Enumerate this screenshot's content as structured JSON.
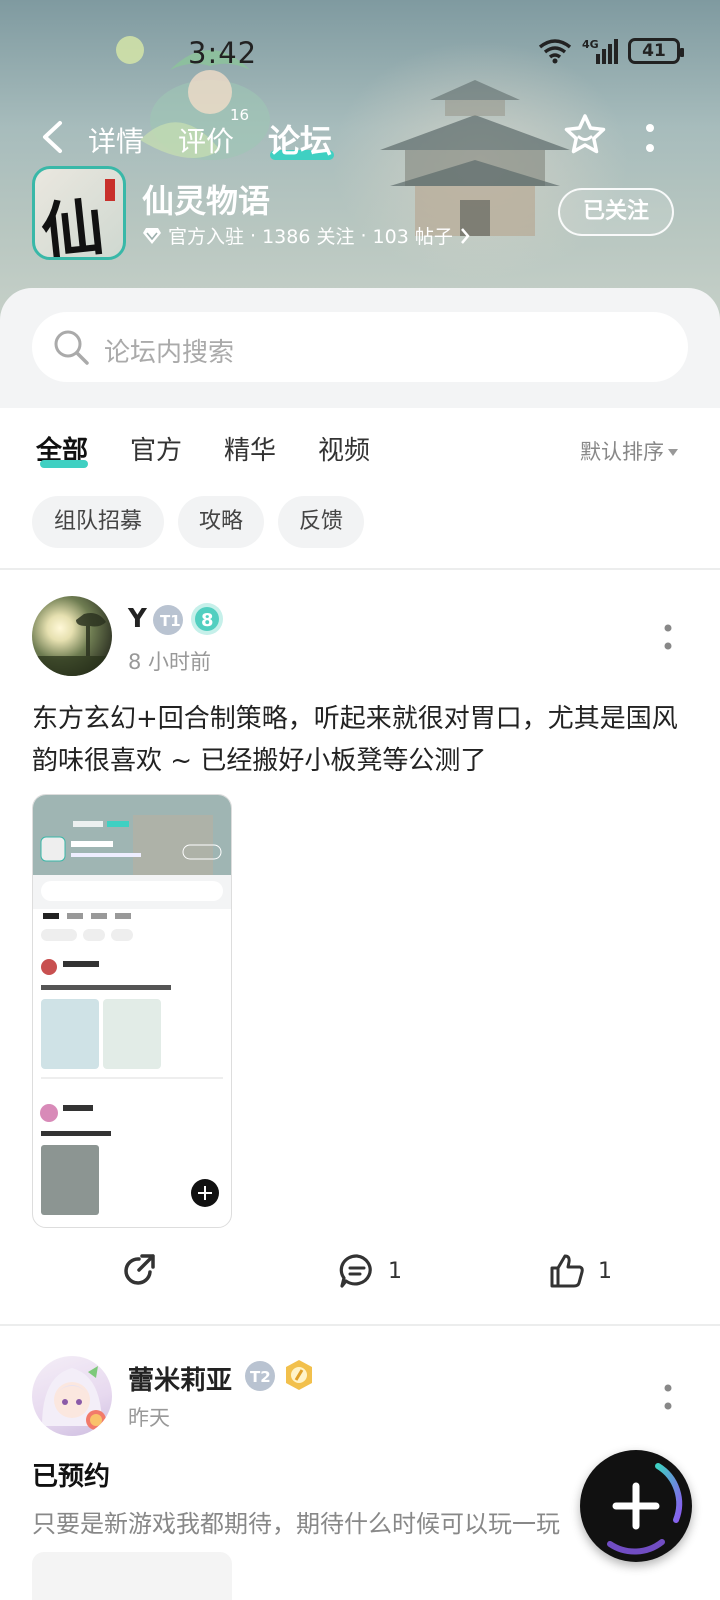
{
  "status": {
    "time": "3:42",
    "network": "4G",
    "battery": "41"
  },
  "nav": {
    "tabs": [
      {
        "label": "详情"
      },
      {
        "label": "评价",
        "badge": "16"
      },
      {
        "label": "论坛",
        "active": true
      }
    ]
  },
  "game": {
    "title": "仙灵物语",
    "icon_glyph": "仙",
    "official": "官方入驻",
    "followers": "1386 关注",
    "posts": "103 帖子",
    "follow_label": "已关注"
  },
  "search": {
    "placeholder": "论坛内搜索"
  },
  "tabs": [
    {
      "label": "全部",
      "active": true
    },
    {
      "label": "官方"
    },
    {
      "label": "精华"
    },
    {
      "label": "视频"
    }
  ],
  "sort": {
    "label": "默认排序"
  },
  "chips": [
    "组队招募",
    "攻略",
    "反馈"
  ],
  "posts": [
    {
      "author": "Y",
      "level": "T1",
      "time": "8 小时前",
      "text": "东方玄幻+回合制策略，听起来就很对胃口，尤其是国风韵味很喜欢 ~ 已经搬好小板凳等公测了",
      "comments": "1",
      "likes": "1"
    },
    {
      "author": "蕾米莉亚",
      "level": "T2",
      "time": "昨天",
      "title": "已预约",
      "text": "只要是新游戏我都期待，期待什么时候可以玩一玩"
    }
  ],
  "colors": {
    "accent": "#3fd0c2",
    "text": "#222222",
    "muted": "#999999"
  }
}
